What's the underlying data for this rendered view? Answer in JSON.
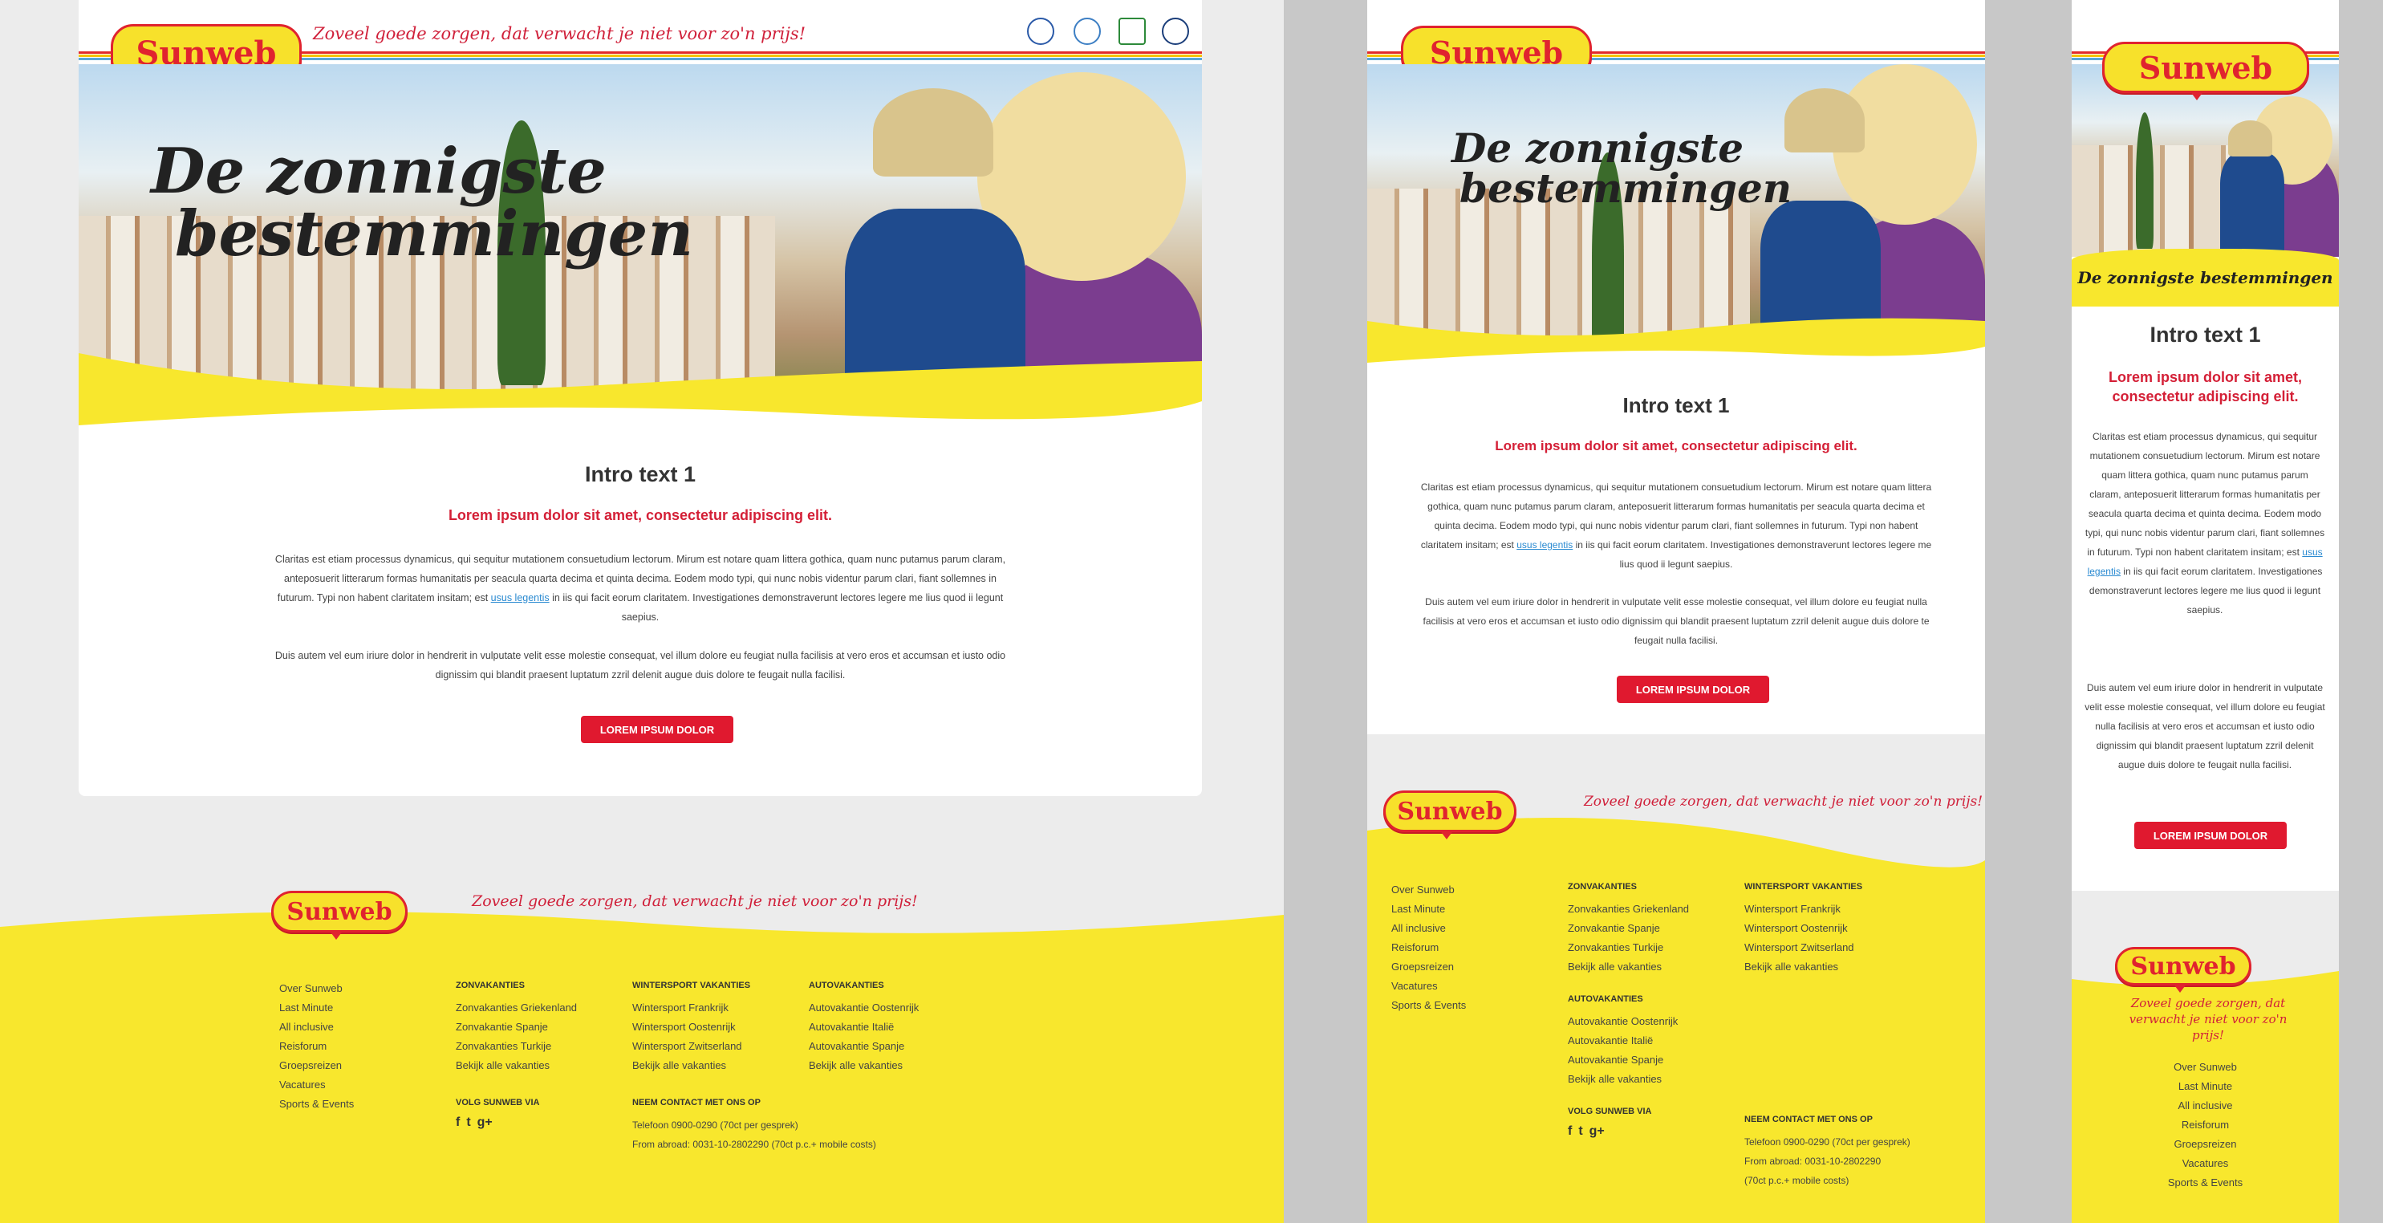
{
  "brand": {
    "logo_text": "Sunweb",
    "tagline": "Zoveel goede zorgen, dat verwacht je niet voor zo'n prijs!"
  },
  "header_badges": [
    "sgr-badge-icon",
    "anvr-badge-icon",
    "house-badge-icon",
    "globe-badge-icon"
  ],
  "hero": {
    "heading_line1": "De zonnigste",
    "heading_line2": "bestemmingen",
    "mobile_caption": "De zonnigste bestemmingen"
  },
  "intro": {
    "title": "Intro text 1",
    "subtitle": "Lorem ipsum dolor sit amet, consectetur adipiscing elit.",
    "para1_a": "Claritas est etiam processus dynamicus, qui sequitur mutationem consuetudium lectorum. Mirum est notare quam littera gothica, quam nunc putamus parum claram, anteposuerit litterarum formas humanitatis per seacula quarta decima et quinta decima. Eodem modo typi, qui nunc nobis videntur parum clari, fiant sollemnes in futurum. Typi non habent claritatem insitam; est ",
    "para1_link": "usus legentis",
    "para1_b": " in iis qui facit eorum claritatem. Investigationes demonstraverunt lectores legere me lius quod ii legunt saepius.",
    "para2": "Duis autem vel eum iriure dolor in hendrerit in vulputate velit esse molestie consequat, vel illum dolore eu feugiat nulla facilisis at vero eros et accumsan et iusto odio dignissim qui blandit praesent luptatum zzril delenit augue duis dolore te feugait nulla facilisi.",
    "button": "LOREM IPSUM DOLOR"
  },
  "footer": {
    "nav": [
      "Over Sunweb",
      "Last Minute",
      "All inclusive",
      "Reisforum",
      "Groepsreizen",
      "Vacatures",
      "Sports & Events"
    ],
    "zon": {
      "heading": "ZONVAKANTIES",
      "links": [
        "Zonvakanties Griekenland",
        "Zonvakantie Spanje",
        "Zonvakanties Turkije",
        "Bekijk alle vakanties"
      ]
    },
    "winter": {
      "heading": "WINTERSPORT VAKANTIES",
      "links": [
        "Wintersport Frankrijk",
        "Wintersport Oostenrijk",
        "Wintersport Zwitserland",
        "Bekijk alle vakanties"
      ]
    },
    "auto": {
      "heading": "AUTOVAKANTIES",
      "links": [
        "Autovakantie Oostenrijk",
        "Autovakantie Italië",
        "Autovakantie Spanje",
        "Bekijk alle vakanties"
      ]
    },
    "social": {
      "heading": "VOLG SUNWEB VIA",
      "icons": [
        "facebook-icon",
        "twitter-icon",
        "google-plus-icon"
      ],
      "f": "f",
      "t": "t",
      "g": "g+"
    },
    "contact": {
      "heading": "NEEM CONTACT MET ONS OP",
      "phone": "Telefoon 0900-0290 (70ct per gesprek)",
      "abroad": "From abroad: 0031-10-2802290 (70ct p.c.+ mobile costs)",
      "abroad_short": "From abroad: 0031-10-2802290",
      "abroad_cost": "(70ct p.c.+ mobile costs)"
    }
  },
  "colors": {
    "brand_yellow": "#f8e72d",
    "brand_red": "#e0192f",
    "link_blue": "#2a8ad1"
  }
}
